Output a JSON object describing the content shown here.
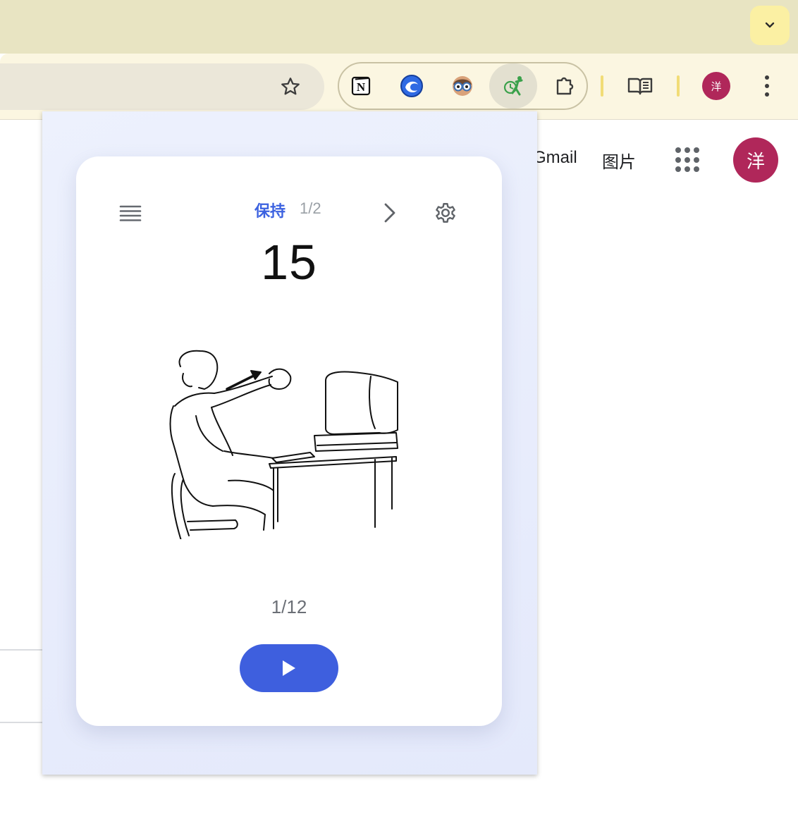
{
  "browser": {
    "profile_initial": "洋",
    "extensions": [
      {
        "name": "notion-icon",
        "glyph": "N"
      },
      {
        "name": "edge-like-icon"
      },
      {
        "name": "eyes-extension-icon"
      },
      {
        "name": "stretch-reminder-icon"
      },
      {
        "name": "extensions-puzzle-icon"
      }
    ]
  },
  "page": {
    "links": {
      "gmail": "Gmail",
      "images": "图片"
    },
    "avatar_initial": "洋"
  },
  "popup": {
    "phase_label": "保持",
    "phase_count": "1/2",
    "timer": "15",
    "progress": "1/12",
    "colors": {
      "accent": "#3e5fde",
      "phase_text": "#3c62e0",
      "avatar": "#b0275a"
    }
  }
}
